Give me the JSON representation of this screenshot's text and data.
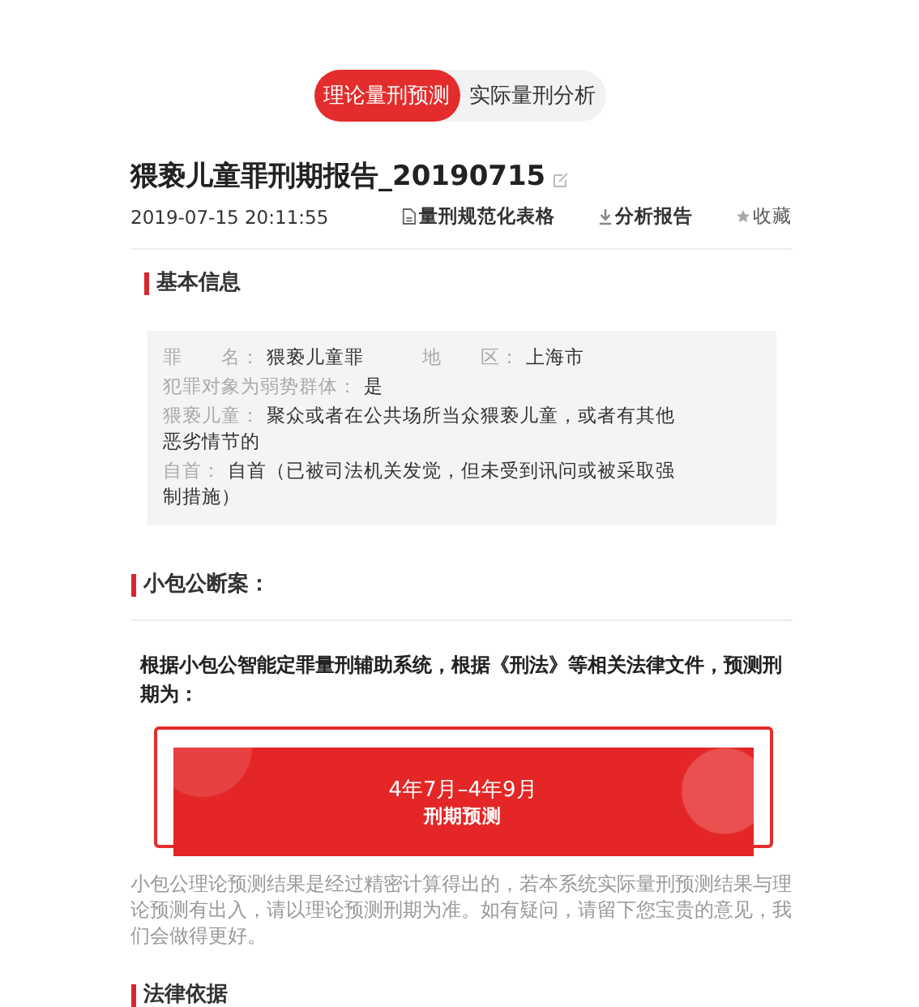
{
  "tabs": [
    {
      "label": "理论量刑预测",
      "selected": true
    },
    {
      "label": "实际量刑分析",
      "selected": false
    }
  ],
  "report": {
    "title": "猥亵儿童罪刑期报告_20190715",
    "date": "2019-07-15 20:11:55",
    "actions": [
      {
        "kind": "document",
        "label": "量刑规范化表格",
        "bold": true
      },
      {
        "kind": "download",
        "label": "分析报告",
        "bold": true
      },
      {
        "kind": "star",
        "label": "收藏",
        "bold": false
      }
    ]
  },
  "basic_info": {
    "heading": "基本信息",
    "rows": [
      [
        {
          "label": "罪　　名：",
          "value": "猥亵儿童罪"
        },
        {
          "label": "地　　区：",
          "value": "上海市"
        }
      ],
      [
        {
          "label": "犯罪对象为弱势群体：",
          "value": "是"
        }
      ],
      [
        {
          "label": "猥亵儿童：",
          "value": "聚众或者在公共场所当众猥亵儿童，或者有其他恶劣情节的"
        }
      ],
      [
        {
          "label": "自首：",
          "value": "自首（已被司法机关发觉，但未受到讯问或被采取强制措施）"
        }
      ]
    ]
  },
  "verdict": {
    "heading": "小包公断案：",
    "intro": "根据小包公智能定罪量刑辅助系统，根据《刑法》等相关法律文件，预测刑期为：",
    "range": "4年7月–4年9月",
    "caption": "刑期预测",
    "note": "小包公理论预测结果是经过精密计算得出的，若本系统实际量刑预测结果与理论预测有出入，请以理论预测刑期为准。如有疑问，请留下您宝贵的意见，我们会做得更好。"
  },
  "law": {
    "heading": "法律依据"
  }
}
